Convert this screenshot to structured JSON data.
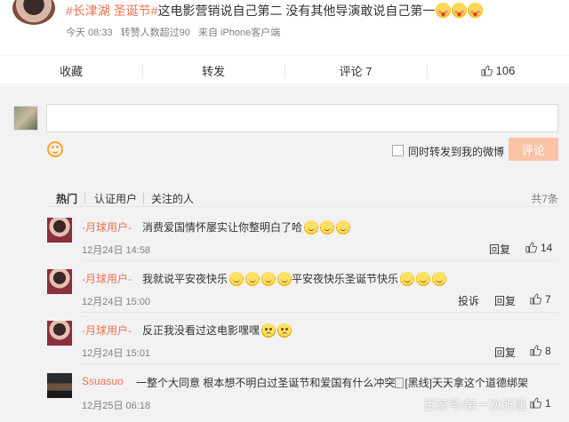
{
  "post": {
    "topic1": "#长津湖",
    "topic2": "圣诞节#",
    "text": "这电影营销说自己第二 没有其他导演敢说自己第一",
    "time": "今天 08:33",
    "likes_note": "转赞人数超过90",
    "source": "来自 iPhone客户端"
  },
  "actions": {
    "favorite": "收藏",
    "forward": "转发",
    "comment": "评论 7",
    "like": "106"
  },
  "composer": {
    "forward_label": "同时转发到我的微博",
    "submit": "评论"
  },
  "tabs": {
    "hot": "热门",
    "verified": "认证用户",
    "following": "关注的人",
    "total": "共7条"
  },
  "comments": [
    {
      "user": "-月球用户-",
      "text": "消费爱国情怀屡实让你整明白了哈",
      "time": "12月24日 14:58",
      "reply": "回复",
      "likes": "14"
    },
    {
      "user": "-月球用户-",
      "text1": "我就说平安夜快乐",
      "text2": "平安夜快乐圣诞节快乐",
      "time": "12月24日 15:00",
      "report": "投诉",
      "reply": "回复",
      "likes": "7"
    },
    {
      "user": "-月球用户-",
      "text": "反正我没看过这电影嘿嘿",
      "time": "12月24日 15:01",
      "reply": "回复",
      "likes": "8"
    },
    {
      "user": "Ssuasuo",
      "text1": "一整个大同意 根本想不明白过圣诞节和爱国有什么冲突",
      "img_alt": "[黑线]",
      "text2": "天天拿这个道德绑架",
      "time": "12月25日 06:18",
      "likes": "1"
    }
  ],
  "watermark": "百家号/第一次所遇"
}
